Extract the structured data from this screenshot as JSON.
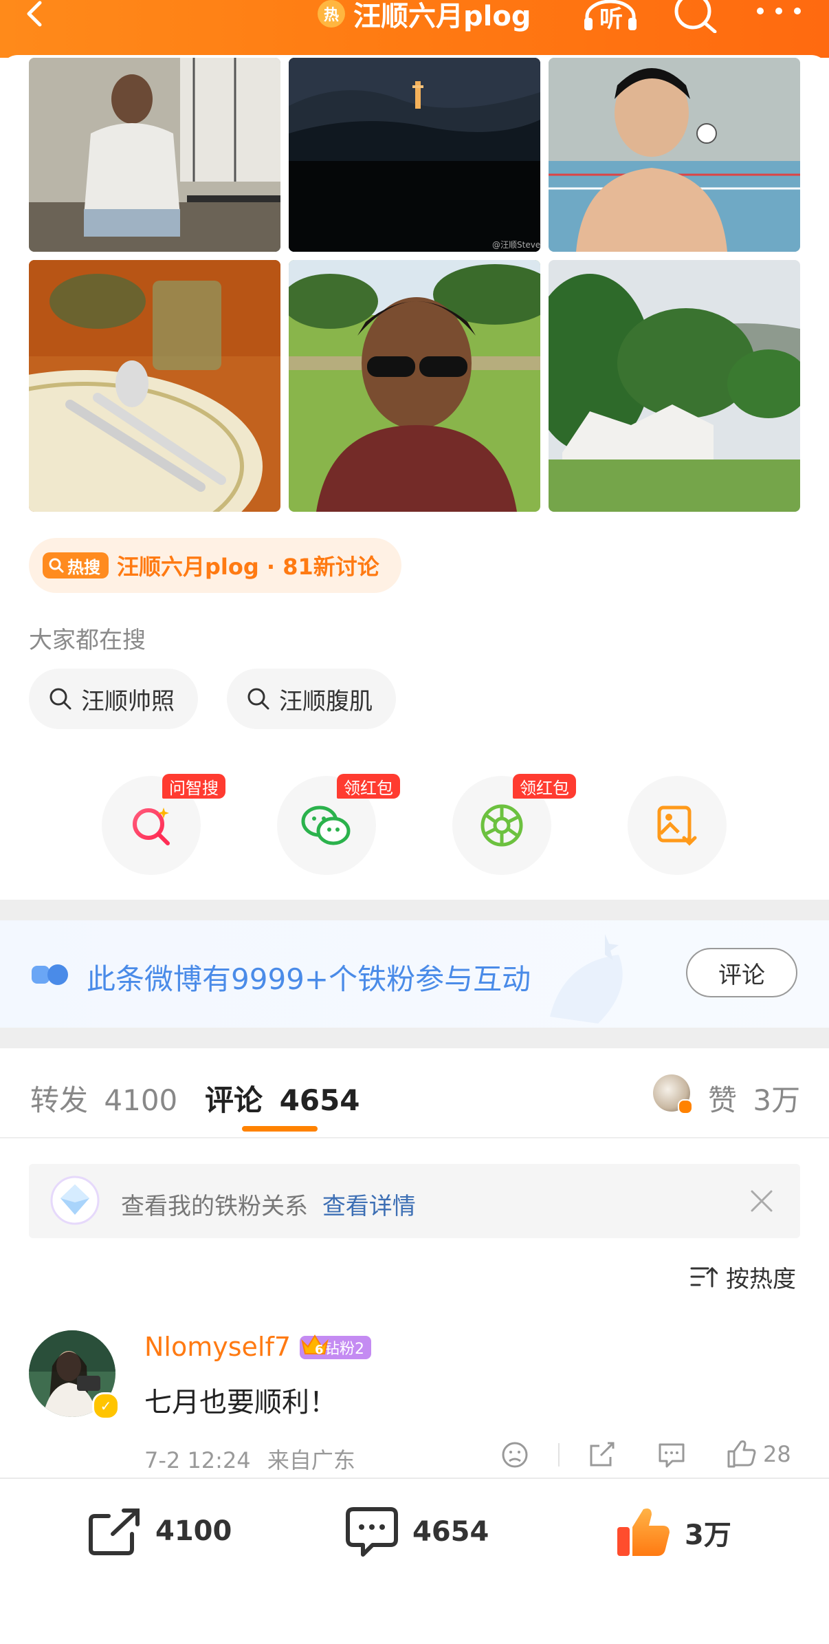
{
  "header": {
    "title": "汪顺六月plog",
    "hot_dot": "热",
    "listen_label": "听",
    "icons": [
      "back-icon",
      "search-icon",
      "more-icon"
    ]
  },
  "photos": {
    "watermark": "@汪顺Steve"
  },
  "hot_search": {
    "tag": "热搜",
    "text": "汪顺六月plog · 81新讨论"
  },
  "suggest": {
    "label": "大家都在搜",
    "chips": [
      "汪顺帅照",
      "汪顺腹肌"
    ]
  },
  "share_actions": [
    {
      "icon": "ai-search-icon",
      "badge": "问智搜"
    },
    {
      "icon": "wechat-icon",
      "badge": "领红包"
    },
    {
      "icon": "moments-icon",
      "badge": "领红包"
    },
    {
      "icon": "save-image-icon",
      "badge": ""
    }
  ],
  "fan_banner": {
    "text": "此条微博有9999+个铁粉参与互动",
    "button": "评论"
  },
  "tabs": {
    "repost_label": "转发",
    "repost_count": "4100",
    "comment_label": "评论",
    "comment_count": "4654",
    "like_label": "赞",
    "like_count": "3万"
  },
  "fan_relation": {
    "text": "查看我的铁粉关系",
    "link": "查看详情"
  },
  "sort": {
    "label": "按热度"
  },
  "comment": {
    "username": "Nlomyself7",
    "fan_level": "钻粉2",
    "crown_level": "6",
    "text": "七月也要顺利！",
    "time": "7-2 12:24",
    "location": "来自广东",
    "likes": "28"
  },
  "bottom": {
    "repost": "4100",
    "comment": "4654",
    "like": "3万"
  },
  "colors": {
    "brand_orange": "#ff8200",
    "link_blue": "#3d6fb4",
    "badge_red": "#ff3b30"
  }
}
